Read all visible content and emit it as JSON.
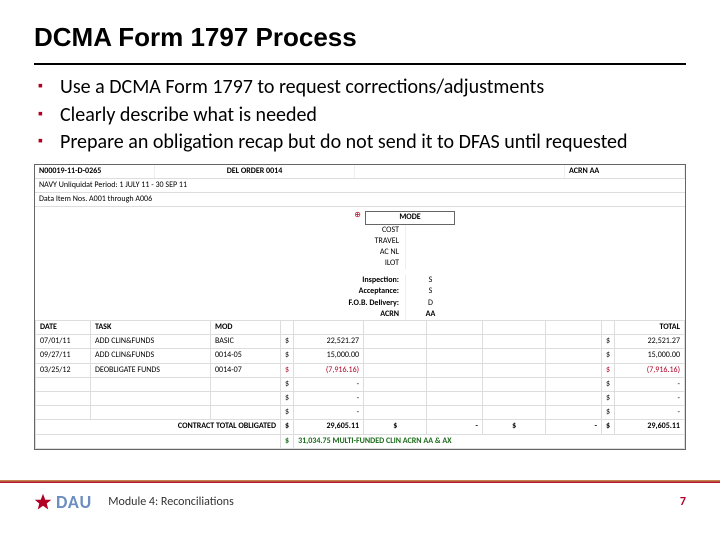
{
  "title": "DCMA Form 1797 Process",
  "bullets": [
    "Use a DCMA Form 1797 to request corrections/adjustments",
    "Clearly describe what is needed",
    "Prepare an obligation recap but do not send it to DFAS until requested"
  ],
  "form": {
    "contract_id": "N00019-11-D-0265",
    "del_order": "DEL ORDER 0014",
    "acrn_label": "ACRN AA",
    "navy_period": "NAVY Unliquidat Period:  1 JULY 11 - 30 SEP 11",
    "data_items": "Data Item Nos. A001 through A006",
    "mode_box": "MODE",
    "rows_meta": [
      {
        "lbl": "COST",
        "val": ""
      },
      {
        "lbl": "TRAVEL",
        "val": ""
      },
      {
        "lbl": "AC NL",
        "val": ""
      },
      {
        "lbl": "ILOT",
        "val": ""
      }
    ],
    "mid_rows": [
      {
        "lbl": "Inspection:",
        "val": "S"
      },
      {
        "lbl": "Acceptance:",
        "val": "S"
      },
      {
        "lbl": "F.O.B. Delivery:",
        "val": "D"
      },
      {
        "lbl": "ACRN",
        "val": "AA"
      }
    ],
    "table": {
      "headers": [
        "DATE",
        "TASK",
        "MOD",
        "",
        "",
        "TOTAL"
      ],
      "rows": [
        {
          "date": "07/01/11",
          "task": "ADD CLIN&FUNDS",
          "mod": "BASIC",
          "amt_s": "$",
          "amt": "22,521.27",
          "tot_s": "$",
          "tot": "22,521.27"
        },
        {
          "date": "09/27/11",
          "task": "ADD CLIN&FUNDS",
          "mod": "0014-05",
          "amt_s": "$",
          "amt": "15,000.00",
          "tot_s": "$",
          "tot": "15,000.00"
        },
        {
          "date": "03/25/12",
          "task": "DEOBLIGATE FUNDS",
          "mod": "0014-07",
          "amt_s": "$",
          "amt": "(7,916.16)",
          "tot_s": "$",
          "tot": "(7,916.16)",
          "neg": true
        }
      ],
      "contract_total_lbl": "CONTRACT    TOTAL OBLIGATED",
      "contract_total": "29,605.11",
      "grand": "31,034.75  MULTI-FUNDED CLIN ACRN AA & AX",
      "grand_right": "29,605.11"
    }
  },
  "footer": {
    "logo_text": "DAU",
    "module": "Module 4: Reconciliations",
    "page": "7"
  }
}
